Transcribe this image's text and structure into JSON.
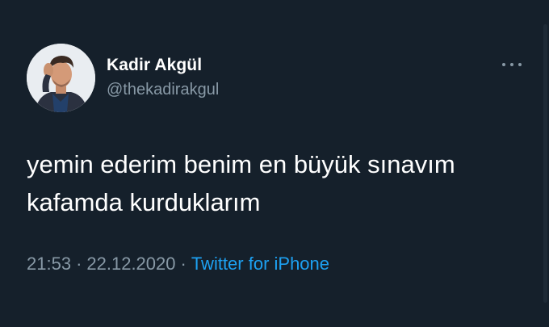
{
  "author": {
    "display_name": "Kadir Akgül",
    "handle": "@thekadirakgul",
    "avatar_icon": "profile-photo"
  },
  "tweet": {
    "lines": [
      "yemin ederim benim en büyük sınavım",
      "kafamda kurduklarım"
    ]
  },
  "meta": {
    "time": "21:53",
    "separator": "·",
    "date": "22.12.2020",
    "source": "Twitter for iPhone"
  },
  "actions": {
    "more_icon": "more-horizontal-icon"
  },
  "colors": {
    "background": "#15202b",
    "text": "#ffffff",
    "secondary": "#8899a6",
    "link": "#1da1f2"
  }
}
